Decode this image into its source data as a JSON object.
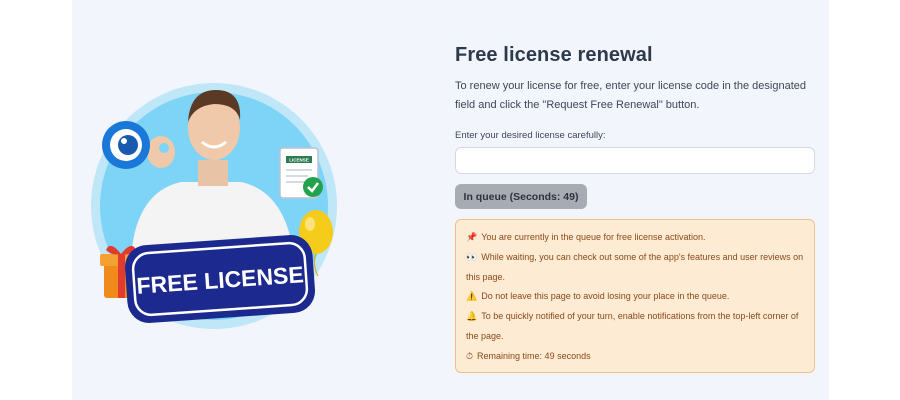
{
  "hero": {
    "badge_text": "FREE LICENSE",
    "doc_label": "LICENSE"
  },
  "form": {
    "title": "Free license renewal",
    "description": "To renew your license for free, enter your license code in the designated field and click the \"Request Free Renewal\" button.",
    "field_label": "Enter your desired license carefully:",
    "input_value": "",
    "input_placeholder": "",
    "queue_button_label": "In queue (Seconds: 49)"
  },
  "notice": {
    "lines": [
      {
        "icon": "📌",
        "icon_name": "pushpin-icon",
        "text": "You are currently in the queue for free license activation."
      },
      {
        "icon": "👀",
        "icon_name": "eyes-icon",
        "text": "While waiting, you can check out some of the app's features and user reviews on this page."
      },
      {
        "icon": "⚠️",
        "icon_name": "warning-icon",
        "text": "Do not leave this page to avoid losing your place in the queue."
      },
      {
        "icon": "🔔",
        "icon_name": "bell-icon",
        "text": "To be quickly notified of your turn, enable notifications from the top-left corner of the page."
      },
      {
        "icon": "⏱",
        "icon_name": "stopwatch-icon",
        "text": "Remaining time: 49 seconds"
      }
    ]
  },
  "colors": {
    "panel_bg": "#f3f5fc",
    "notice_bg": "#fdebd3",
    "notice_border": "#f0c089",
    "notice_text": "#8a4a1a",
    "button_bg": "#a6abb4",
    "title": "#2d3a4b"
  }
}
